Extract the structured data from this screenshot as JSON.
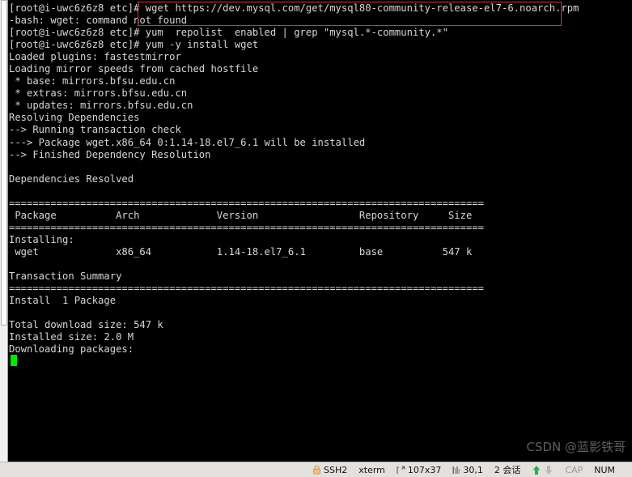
{
  "terminal": {
    "prompt": "[root@i-uwc6z6z8 etc]# ",
    "lines": [
      "[root@i-uwc6z6z8 etc]# wget https://dev.mysql.com/get/mysql80-community-release-el7-6.noarch.rpm",
      "-bash: wget: command not found",
      "[root@i-uwc6z6z8 etc]# yum  repolist  enabled | grep \"mysql.*-community.*\"",
      "[root@i-uwc6z6z8 etc]# yum -y install wget",
      "Loaded plugins: fastestmirror",
      "Loading mirror speeds from cached hostfile",
      " * base: mirrors.bfsu.edu.cn",
      " * extras: mirrors.bfsu.edu.cn",
      " * updates: mirrors.bfsu.edu.cn",
      "Resolving Dependencies",
      "--> Running transaction check",
      "---> Package wget.x86_64 0:1.14-18.el7_6.1 will be installed",
      "--> Finished Dependency Resolution",
      "",
      "Dependencies Resolved",
      "",
      "================================================================================",
      " Package          Arch             Version                 Repository     Size",
      "================================================================================",
      "Installing:",
      " wget             x86_64           1.14-18.el7_6.1         base          547 k",
      "",
      "Transaction Summary",
      "================================================================================",
      "Install  1 Package",
      "",
      "Total download size: 547 k",
      "Installed size: 2.0 M",
      "Downloading packages:"
    ],
    "cursor": {
      "shape": "block",
      "color": "#00e700"
    },
    "colors": {
      "background": "#000000",
      "foreground": "#d6d6d6",
      "highlight_border": "#e03131"
    },
    "highlighted_command": "wget https://dev.mysql.com/get/mysql80-community-release-el7-6.noarch.rpm"
  },
  "watermark": {
    "text": "CSDN @蓝影铁哥"
  },
  "status_bar": {
    "protocol": "SSH2",
    "terminal_type": "xterm",
    "dimensions": "107x37",
    "cursor_position": "30,1",
    "sessions": "2 会话",
    "cap": "CAP",
    "num": "NUM"
  }
}
